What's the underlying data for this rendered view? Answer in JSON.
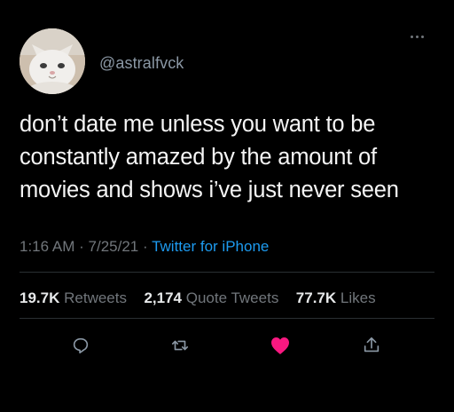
{
  "user": {
    "handle": "@astralfvck"
  },
  "tweet": {
    "lines": [
      "don’t date me unless you want to be",
      "constantly amazed by the amount of",
      "movies and shows i’ve just never seen"
    ]
  },
  "meta": {
    "time": "1:16 AM",
    "separator": "·",
    "date": "7/25/21",
    "source": "Twitter for iPhone"
  },
  "stats": {
    "retweets_count": "19.7K",
    "retweets_label": "Retweets",
    "quotes_count": "2,174",
    "quotes_label": "Quote Tweets",
    "likes_count": "77.7K",
    "likes_label": "Likes"
  },
  "colors": {
    "background": "#000000",
    "text": "#e7e9ea",
    "muted": "#71767b",
    "link": "#1d9bf0",
    "like": "#f91880"
  },
  "icons": {
    "more": "more-horizontal-icon",
    "reply": "reply-icon",
    "retweet": "retweet-icon",
    "like": "heart-icon",
    "share": "share-icon"
  }
}
